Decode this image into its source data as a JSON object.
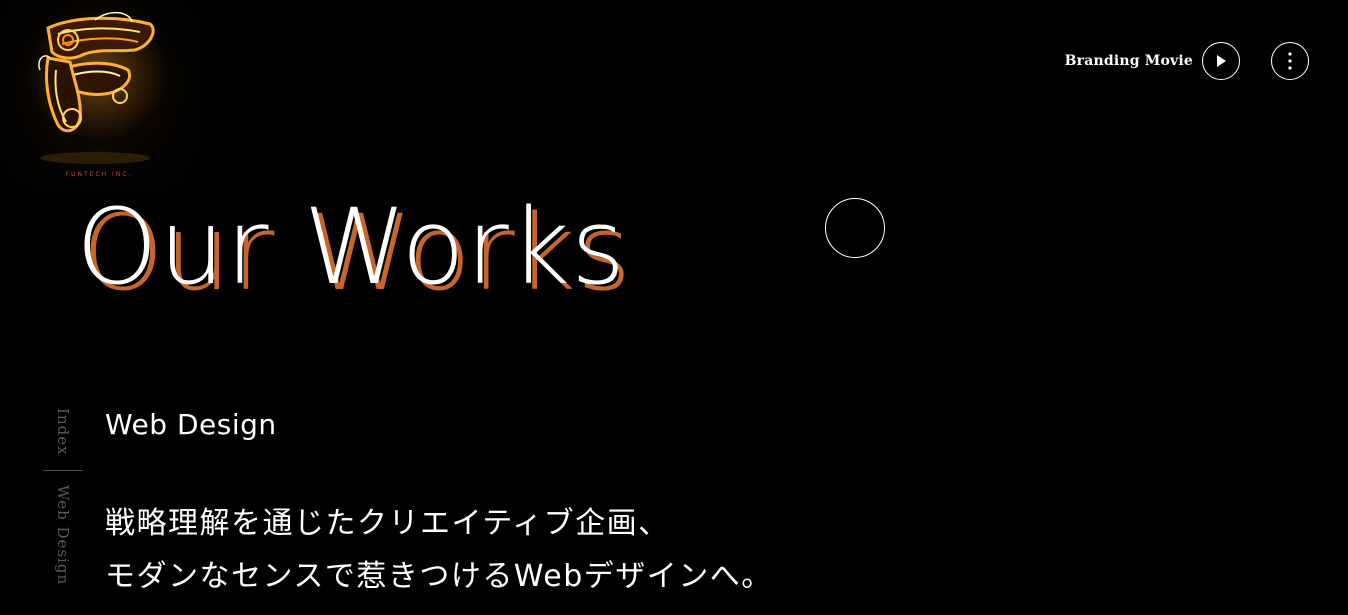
{
  "logo": {
    "caption": "FUNTECH INC."
  },
  "header": {
    "branding_movie_label": "Branding Movie",
    "play_icon": "play-icon",
    "menu_icon": "vertical-dots-icon"
  },
  "hero": {
    "title": "Our Works"
  },
  "side_index": {
    "index_label": "Index",
    "current_label": "Web Design"
  },
  "section": {
    "title": "Web Design",
    "lead_lines": [
      "戦略理解を通じたクリエイティブ企画、",
      "モダンなセンスで惹きつけるWebデザインへ。"
    ]
  },
  "colors": {
    "background": "#000000",
    "accent_orange": "#c8662a",
    "text": "#ffffff",
    "muted": "#5a5a5a"
  }
}
